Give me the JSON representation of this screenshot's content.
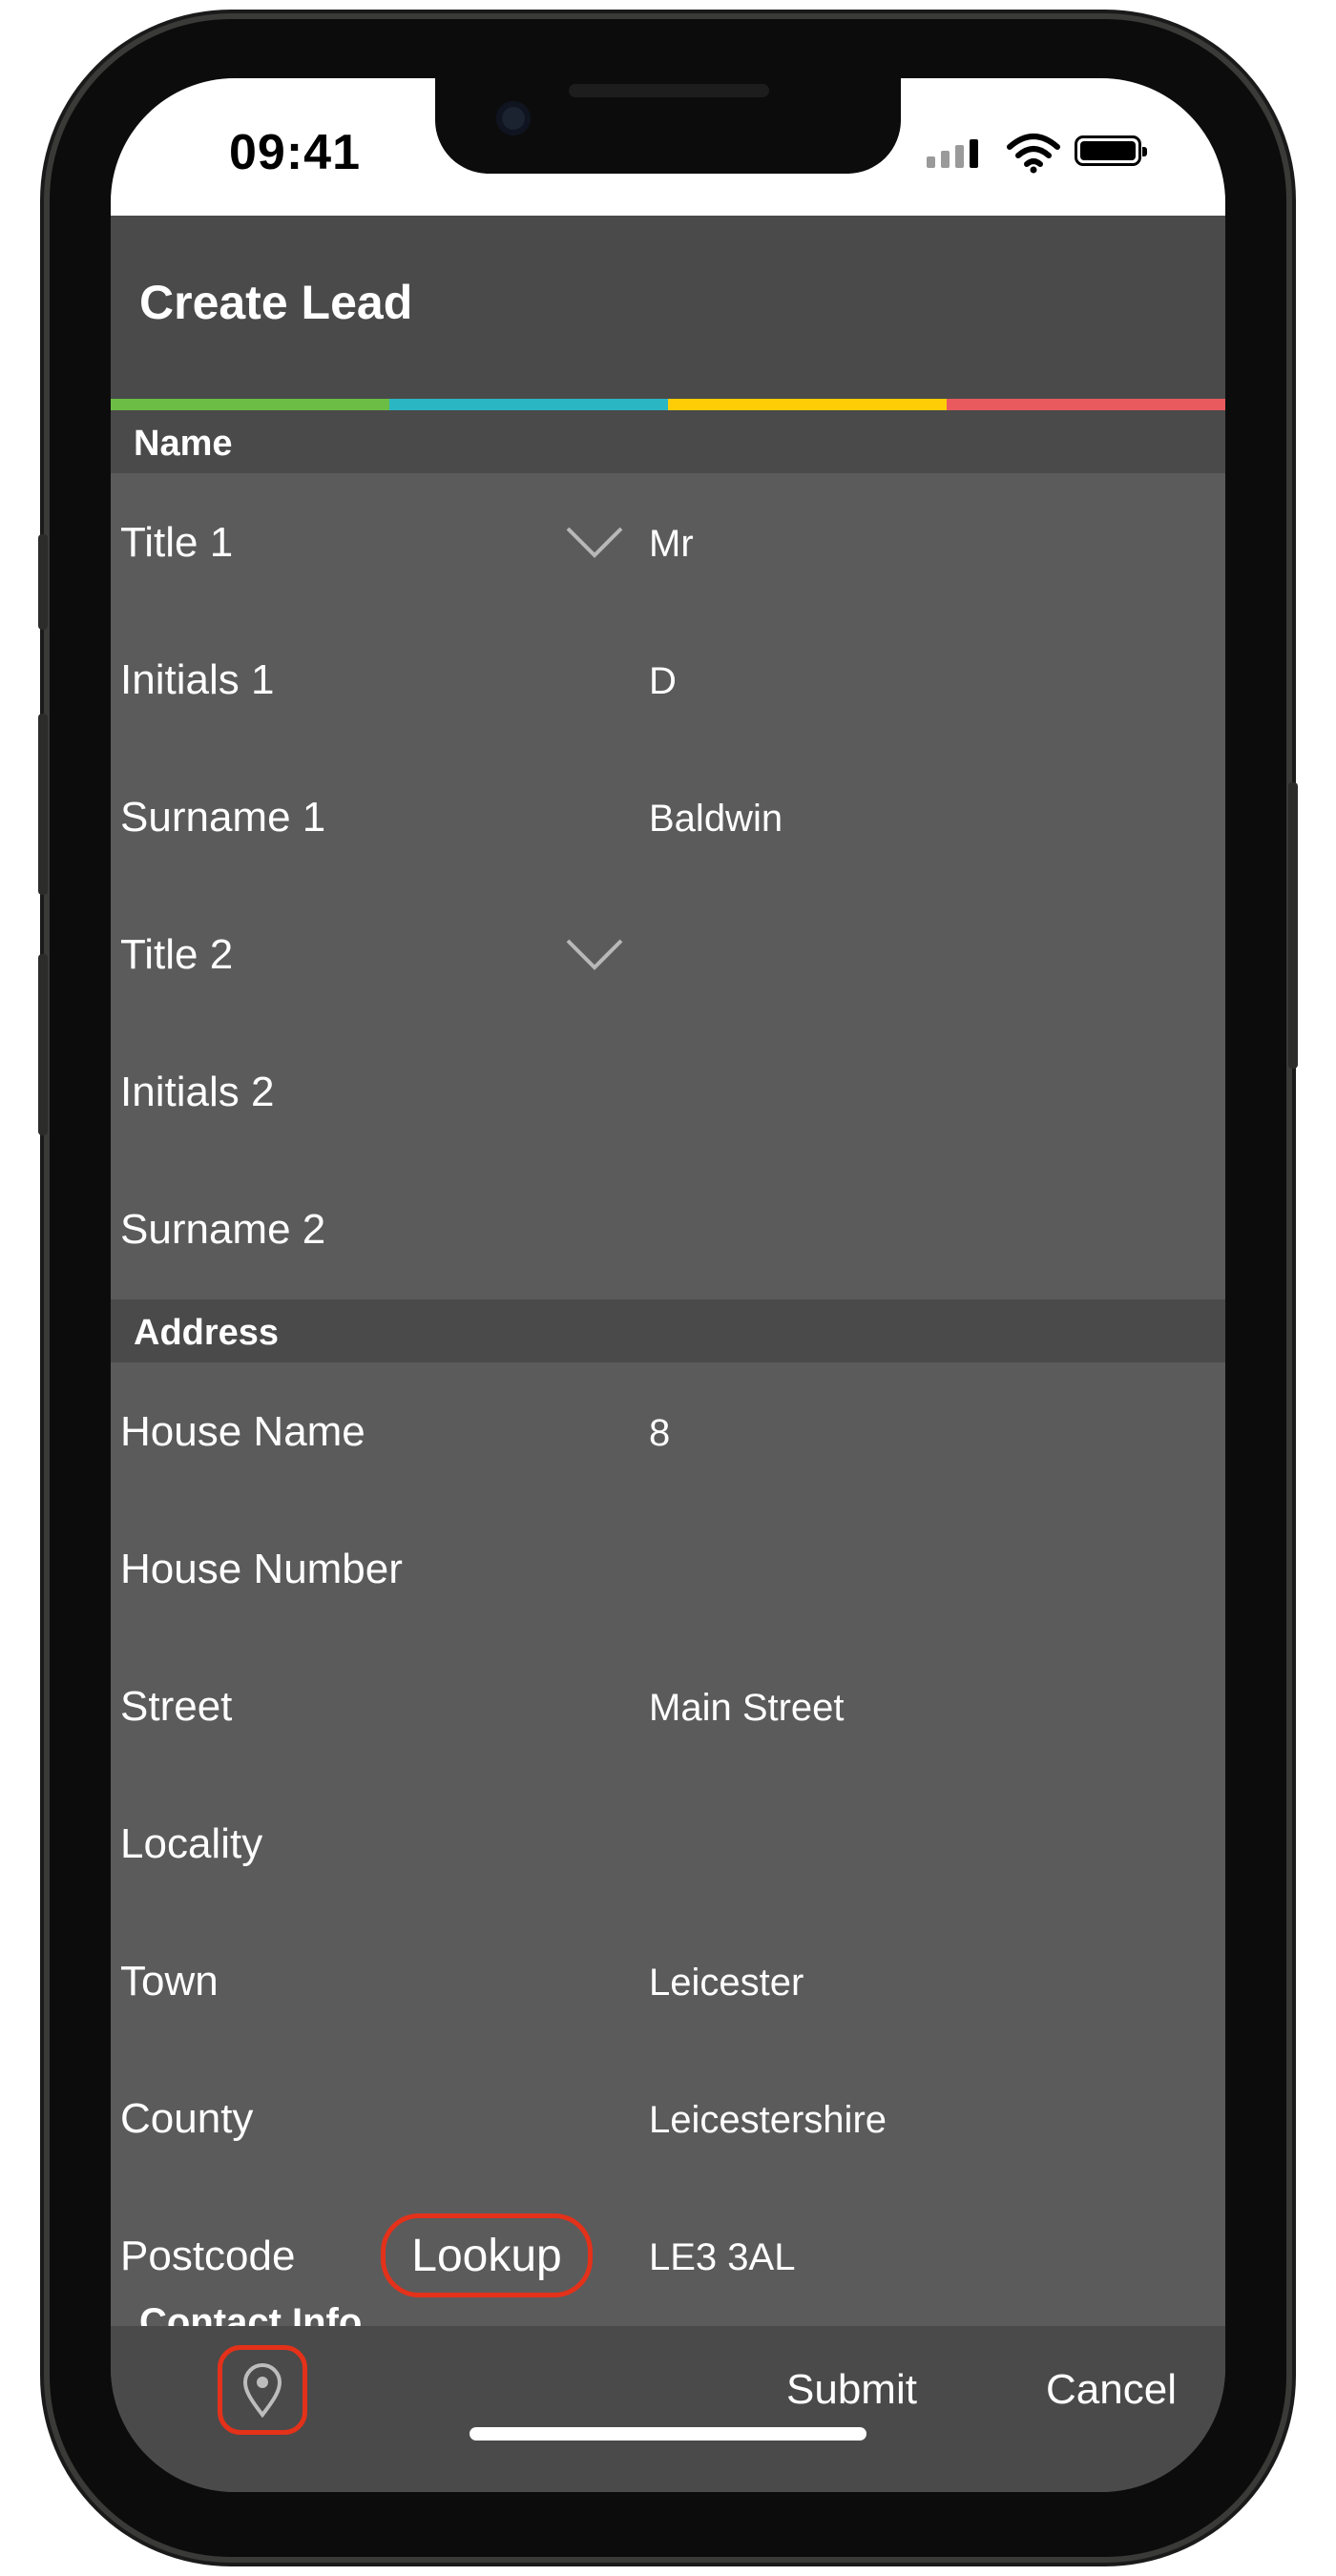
{
  "status_bar": {
    "time": "09:41"
  },
  "header": {
    "title": "Create Lead"
  },
  "colors": {
    "stripe_green": "#6cbd45",
    "stripe_teal": "#2bb6c4",
    "stripe_yellow": "#ffcd05",
    "stripe_red": "#e95a5e",
    "background": "#5b5b5b",
    "header_bg": "#4a4a4a",
    "highlight_red": "#e4311a"
  },
  "sections": {
    "name": {
      "label": "Name",
      "rows": [
        {
          "label": "Title 1",
          "value": "Mr"
        },
        {
          "label": "Initials 1",
          "value": "D"
        },
        {
          "label": "Surname 1",
          "value": "Baldwin"
        },
        {
          "label": "Title 2",
          "value": ""
        },
        {
          "label": "Initials 2",
          "value": ""
        },
        {
          "label": "Surname 2",
          "value": ""
        }
      ]
    },
    "address": {
      "label": "Address",
      "rows": [
        {
          "label": "House Name",
          "value": "8"
        },
        {
          "label": "House Number",
          "value": ""
        },
        {
          "label": "Street",
          "value": "Main Street"
        },
        {
          "label": "Locality",
          "value": ""
        },
        {
          "label": "Town",
          "value": "Leicester"
        },
        {
          "label": "County",
          "value": "Leicestershire"
        },
        {
          "label": "Postcode",
          "value": "LE3 3AL",
          "lookup_label": "Lookup"
        }
      ]
    }
  },
  "footer": {
    "partial_section": "Contact Info",
    "location_icon": "map-pin-icon",
    "submit_label": "Submit",
    "cancel_label": "Cancel"
  }
}
